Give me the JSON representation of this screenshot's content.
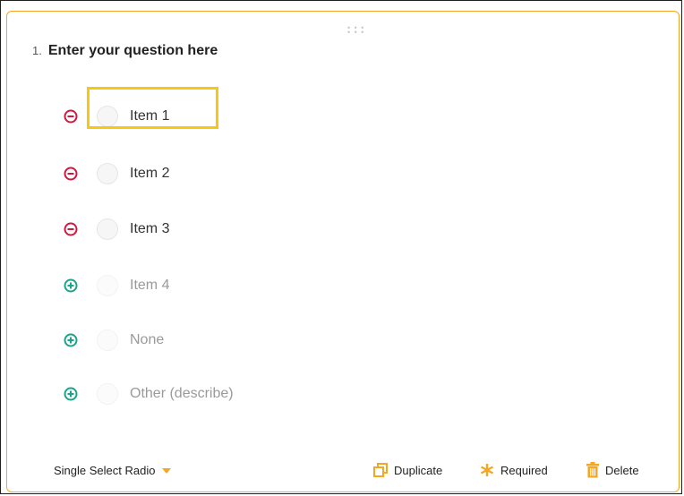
{
  "question": {
    "number": "1.",
    "text": "Enter your question here"
  },
  "options": [
    {
      "label": "Item 1",
      "state": "active",
      "icon": "remove-circle-icon"
    },
    {
      "label": "Item 2",
      "state": "active",
      "icon": "remove-circle-icon"
    },
    {
      "label": "Item 3",
      "state": "active",
      "icon": "remove-circle-icon"
    },
    {
      "label": "Item 4",
      "state": "suggested",
      "icon": "add-circle-icon"
    },
    {
      "label": "None",
      "state": "suggested",
      "icon": "add-circle-icon"
    },
    {
      "label": "Other (describe)",
      "state": "suggested",
      "icon": "add-circle-icon"
    }
  ],
  "footer": {
    "type_label": "Single Select Radio",
    "duplicate_label": "Duplicate",
    "required_label": "Required",
    "delete_label": "Delete"
  },
  "colors": {
    "accent": "#f5a623",
    "remove": "#d0193f",
    "add": "#1aa58a",
    "highlight": "#f7c812"
  }
}
